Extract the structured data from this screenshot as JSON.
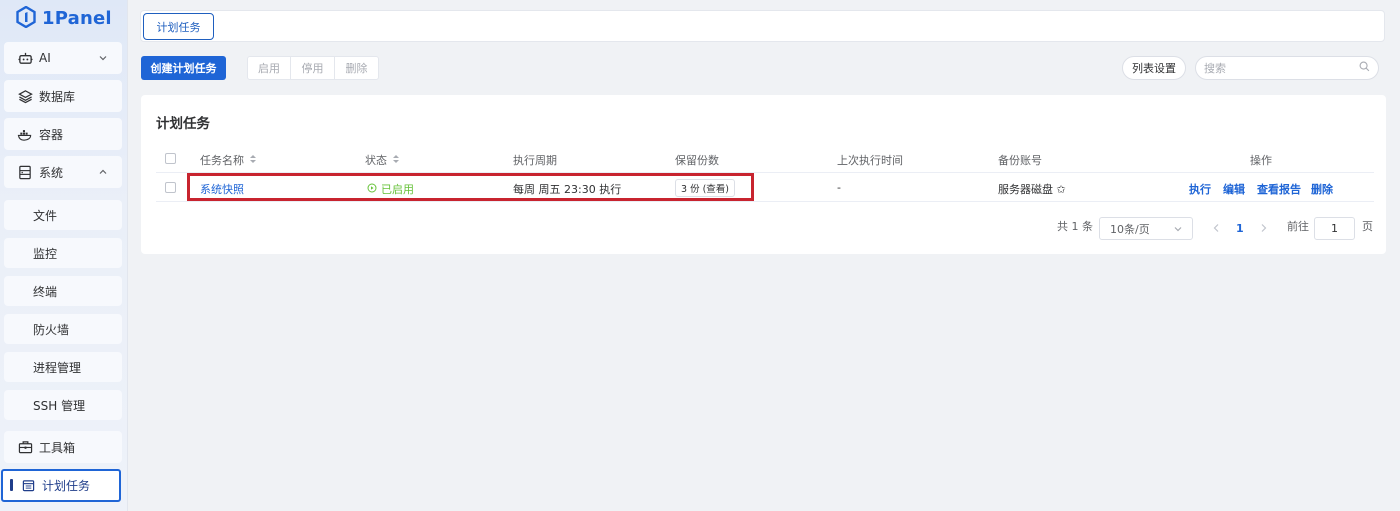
{
  "brand": {
    "name": "1Panel"
  },
  "sidebar": {
    "items": [
      {
        "label": "AI",
        "icon": "robot-icon"
      },
      {
        "label": "数据库",
        "icon": "layers-icon"
      },
      {
        "label": "容器",
        "icon": "docker-icon"
      },
      {
        "label": "系统",
        "icon": "server-icon"
      },
      {
        "label": "工具箱",
        "icon": "toolbox-icon"
      },
      {
        "label": "计划任务",
        "icon": "calendar-icon"
      }
    ],
    "system_sub": [
      "文件",
      "监控",
      "终端",
      "防火墙",
      "进程管理",
      "SSH 管理"
    ]
  },
  "tabs": [
    "计划任务"
  ],
  "toolbar": {
    "create_label": "创建计划任务",
    "enable_label": "启用",
    "disable_label": "停用",
    "delete_label": "删除",
    "columns_label": "列表设置",
    "search_placeholder": "搜索"
  },
  "card": {
    "title": "计划任务"
  },
  "table": {
    "headers": [
      "任务名称",
      "状态",
      "执行周期",
      "保留份数",
      "上次执行时间",
      "备份账号",
      "操作"
    ],
    "rows": [
      {
        "name": "系统快照",
        "status": "已启用",
        "cycle": "每周 周五 23:30 执行",
        "retain": "3 份 (查看)",
        "last_run": "-",
        "account": "服务器磁盘 ✩",
        "actions": [
          "执行",
          "编辑",
          "查看报告",
          "删除"
        ]
      }
    ]
  },
  "pagination": {
    "total": "共 1 条",
    "page_size": "10条/页",
    "current": "1",
    "goto_prefix": "前往",
    "goto_value": "1",
    "goto_suffix": "页"
  },
  "colors": {
    "primary": "#1f65d6",
    "success": "#67c23a",
    "highlight": "#c8242f"
  }
}
